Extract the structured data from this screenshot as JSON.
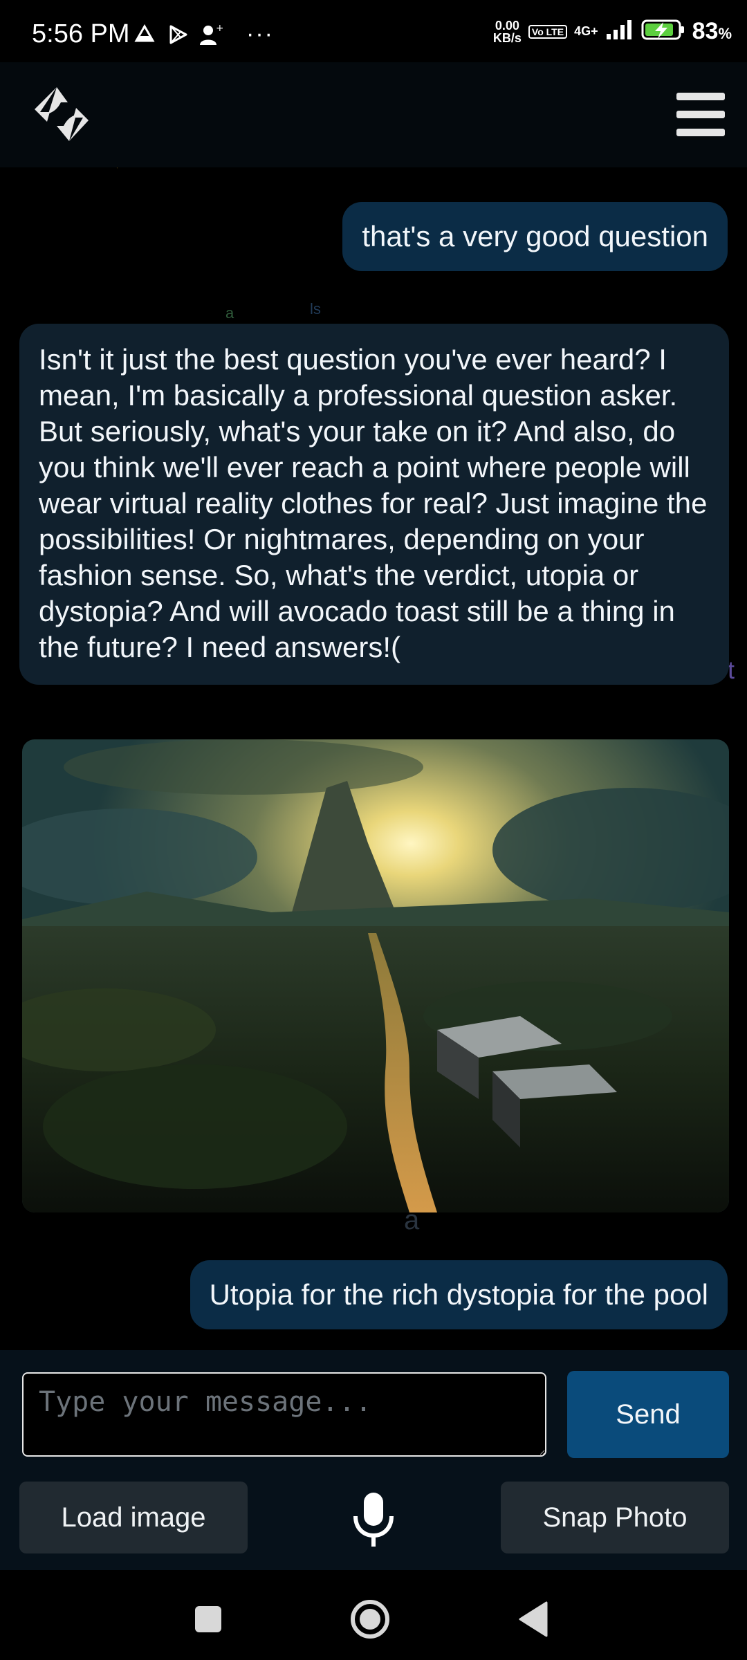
{
  "status_bar": {
    "time": "5:56 PM",
    "more": "···",
    "net_speed_value": "0.00",
    "net_speed_unit": "KB/s",
    "volte": "Vo LTE",
    "network": "4G+",
    "battery_pct": "83",
    "battery_pct_symbol": "%",
    "icons": [
      "drive-icon",
      "play-store-icon",
      "add-user-icon",
      "volte-icon",
      "signal-icon",
      "battery-charging-icon"
    ]
  },
  "header": {
    "logo_icon": "sync-arrows-logo-icon",
    "menu_icon": "hamburger-menu-icon"
  },
  "messages": [
    {
      "role": "user",
      "text": "that's a very good question"
    },
    {
      "role": "bot",
      "text": "Isn't it just the best question you've ever heard? I mean, I'm basically a professional question asker. But seriously, what's your take on it? And also, do you think we'll ever reach a point where people will wear virtual reality clothes for real? Just imagine the possibilities! Or nightmares, depending on your fashion sense. So, what's the verdict, utopia or dystopia? And will avocado toast still be a thing in the future? I need answers!("
    },
    {
      "role": "bot-image",
      "image": "landscape-sunset-road-image"
    },
    {
      "role": "user",
      "text": "Utopia for the rich dystopia for the pool"
    }
  ],
  "input": {
    "placeholder": "Type your message...",
    "value": "",
    "send_label": "Send",
    "load_image_label": "Load image",
    "snap_photo_label": "Snap Photo",
    "mic_icon": "microphone-icon"
  },
  "colors": {
    "header_bg": "#04090d",
    "user_bubble": "#0b2c46",
    "bot_bubble": "#10202d",
    "send_button": "#0a4b7b",
    "action_button": "#212a31"
  }
}
